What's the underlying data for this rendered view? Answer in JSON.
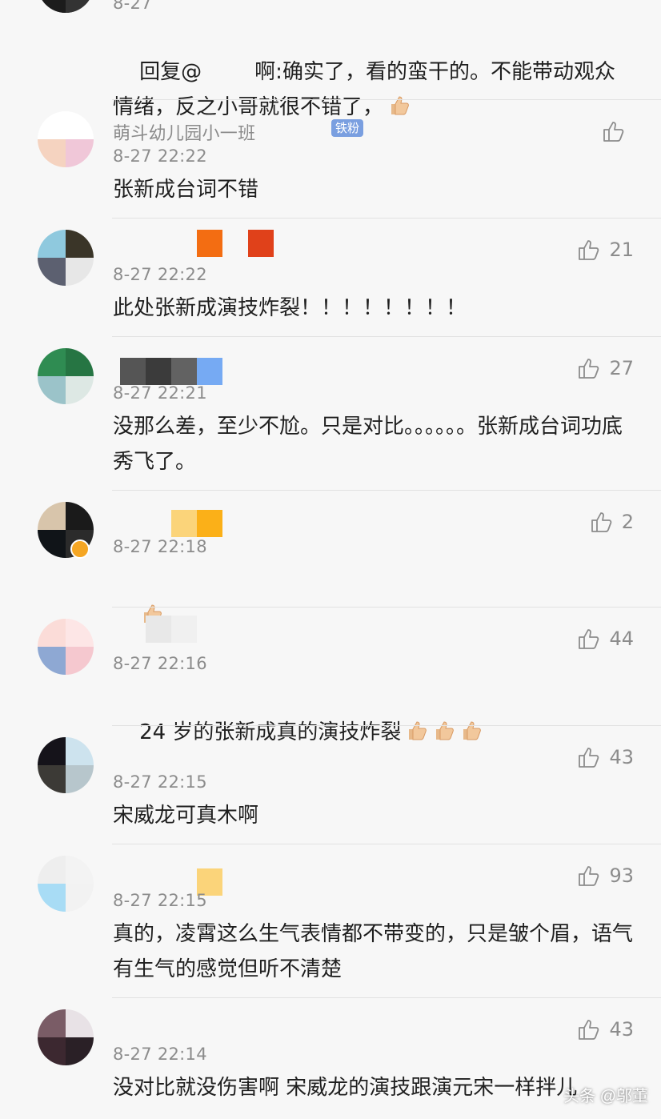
{
  "comments": [
    {
      "time": "8-27",
      "text": "回复@        啊:确实了，看的蛮干的。不能带动观众情绪，反之小哥就很不错了，",
      "emoji": "thumbs-up",
      "likes": ""
    },
    {
      "name": "萌斗幼儿园小一班",
      "badge": "铁粉",
      "time": "8-27 22:22",
      "text": "张新成台词不错",
      "likes": ""
    },
    {
      "time": "8-27 22:22",
      "text": "此处张新成演技炸裂！！！！！！！！",
      "likes": "21"
    },
    {
      "time": "8-27 22:21",
      "text": "没那么差，至少不尬。只是对比。。。。。。张新成台词功底秀飞了。",
      "likes": "27"
    },
    {
      "time": "8-27 22:18",
      "text": "",
      "emoji": "thumbs-up",
      "likes": "2"
    },
    {
      "time": "8-27 22:16",
      "text": "24 岁的张新成真的演技炸裂",
      "emoji_count": 3,
      "likes": "44"
    },
    {
      "time": "8-27 22:15",
      "text": "宋威龙可真木啊",
      "likes": "43"
    },
    {
      "time": "8-27 22:15",
      "text": "真的，凌霄这么生气表情都不带变的，只是皱个眉，语气有生气的感觉但听不清楚",
      "likes": "93"
    },
    {
      "time": "8-27 22:14",
      "text": "没对比就没伤害啊 宋威龙的演技跟演元宋一样拌儿",
      "likes": "43"
    }
  ],
  "watermark": "头条 @邬董",
  "colors": {
    "background": "#f7f7f7",
    "text": "#1f1f1f",
    "meta": "#8c8c8c",
    "badge": "#7a9fe0"
  }
}
